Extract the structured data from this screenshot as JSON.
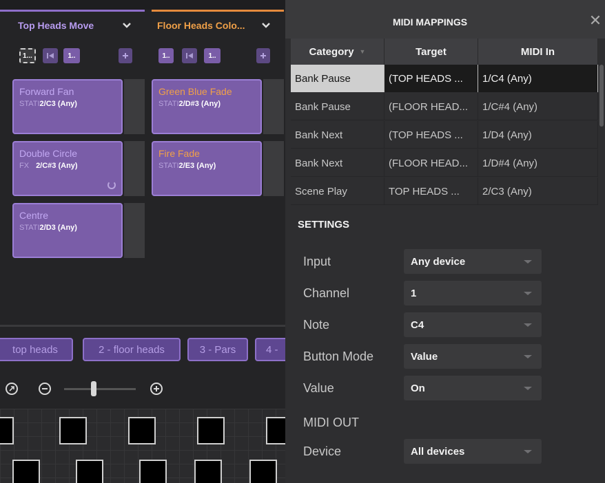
{
  "left": {
    "columns": [
      {
        "title": "Top Heads Move",
        "chevron": "chevron-down-icon",
        "accent": "#8e6ec9"
      },
      {
        "title": "Floor Heads Colo...",
        "chevron": "chevron-down-icon",
        "accent": "#e58a3d"
      }
    ],
    "controls": {
      "col1": {
        "first": "1...",
        "second_icon": "skip-back-icon",
        "third": "1..",
        "add_icon": "plus-icon"
      },
      "col2": {
        "first": "1..",
        "second_icon": "skip-back-icon",
        "third": "1..",
        "add_icon": "plus-icon"
      }
    },
    "tiles": [
      {
        "name": "Forward Fan",
        "mode": "STATI",
        "key": "2/C3 (Any)"
      },
      {
        "name": "Green Blue Fade",
        "mode": "STATI",
        "key": "2/D#3 (Any)"
      },
      {
        "name": "Double Circle",
        "mode": "FX",
        "key": "2/C#3 (Any)",
        "icon": "loop-icon"
      },
      {
        "name": "Fire Fade",
        "mode": "STATI",
        "key": "2/E3 (Any)"
      },
      {
        "name": "Centre",
        "mode": "STATI",
        "key": "2/D3 (Any)"
      }
    ],
    "banks": [
      "top heads",
      "2 - floor heads",
      "3 - Pars",
      "4 - "
    ],
    "zoom": {
      "fit_icon": "target-icon",
      "out_icon": "zoom-out-icon",
      "in_icon": "zoom-in-icon",
      "level": 0.38
    }
  },
  "dialog": {
    "title": "MIDI MAPPINGS",
    "close_icon": "close-icon",
    "table": {
      "headers": [
        "Category",
        "Target",
        "MIDI In"
      ],
      "sort_icon": "sort-down-icon",
      "rows": [
        [
          "Bank Pause",
          "(TOP HEADS ...",
          "1/C4 (Any)"
        ],
        [
          "Bank Pause",
          "(FLOOR HEAD...",
          "1/C#4 (Any)"
        ],
        [
          "Bank Next",
          "(TOP HEADS ...",
          "1/D4 (Any)"
        ],
        [
          "Bank Next",
          "(FLOOR HEAD...",
          "1/D#4 (Any)"
        ],
        [
          "Scene Play",
          "TOP HEADS ...",
          "2/C3 (Any)"
        ]
      ],
      "selected_row": 0
    },
    "settings": {
      "title": "SETTINGS",
      "fields": [
        {
          "label": "Input",
          "value": "Any device"
        },
        {
          "label": "Channel",
          "value": "1"
        },
        {
          "label": "Note",
          "value": "C4"
        },
        {
          "label": "Button Mode",
          "value": "Value"
        },
        {
          "label": "Value",
          "value": "On"
        }
      ],
      "midi_out_label": "MIDI OUT",
      "device": {
        "label": "Device",
        "value": "All devices"
      }
    }
  }
}
